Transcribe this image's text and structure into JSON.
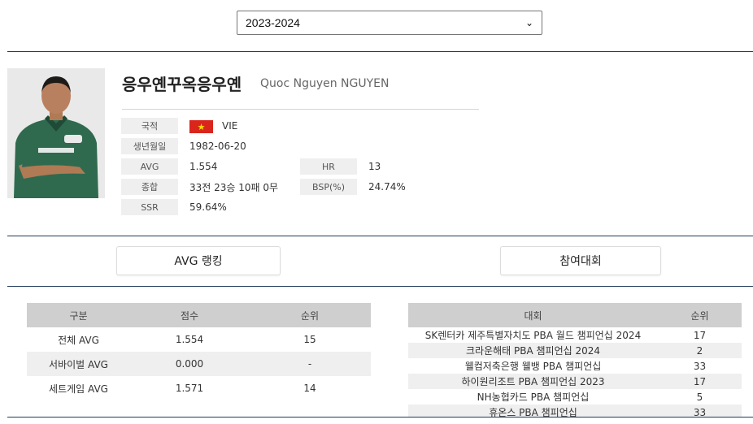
{
  "season_select": {
    "value": "2023-2024"
  },
  "player": {
    "name_ko": "응우옌꾸옥응우옌",
    "name_en": "Quoc Nguyen NGUYEN"
  },
  "info": {
    "nationality_label": "국적",
    "nationality_value": "VIE",
    "birth_label": "생년월일",
    "birth_value": "1982-06-20",
    "avg_label": "AVG",
    "avg_value": "1.554",
    "hr_label": "HR",
    "hr_value": "13",
    "record_label": "종합",
    "record_value": "33전 23승 10패 0무",
    "bsp_label": "BSP(%)",
    "bsp_value": "24.74%",
    "ssr_label": "SSR",
    "ssr_value": "59.64%"
  },
  "tabs": {
    "avg_ranking": "AVG 랭킹",
    "competitions": "참여대회"
  },
  "avg_table": {
    "headers": [
      "구분",
      "점수",
      "순위"
    ],
    "rows": [
      [
        "전체 AVG",
        "1.554",
        "15"
      ],
      [
        "서바이벌 AVG",
        "0.000",
        "-"
      ],
      [
        "세트게임 AVG",
        "1.571",
        "14"
      ]
    ]
  },
  "competitions_table": {
    "headers": [
      "대회",
      "순위"
    ],
    "rows": [
      [
        "SK렌터카 제주특별자치도 PBA 월드 챔피언십 2024",
        "17"
      ],
      [
        "크라운해태 PBA 챔피언십 2024",
        "2"
      ],
      [
        "웰컴저축은행 웰뱅 PBA 챔피언십",
        "33"
      ],
      [
        "하이원리조트 PBA 챔피언십 2023",
        "17"
      ],
      [
        "NH농협카드 PBA 챔피언십",
        "5"
      ],
      [
        "휴온스 PBA 챔피언십",
        "33"
      ]
    ]
  },
  "colors": {
    "rule": "#1f3a5a",
    "label_bg": "#efefef",
    "header_bg": "#cfcfcf",
    "flag_red": "#da251d",
    "flag_star": "#ffdd00"
  }
}
